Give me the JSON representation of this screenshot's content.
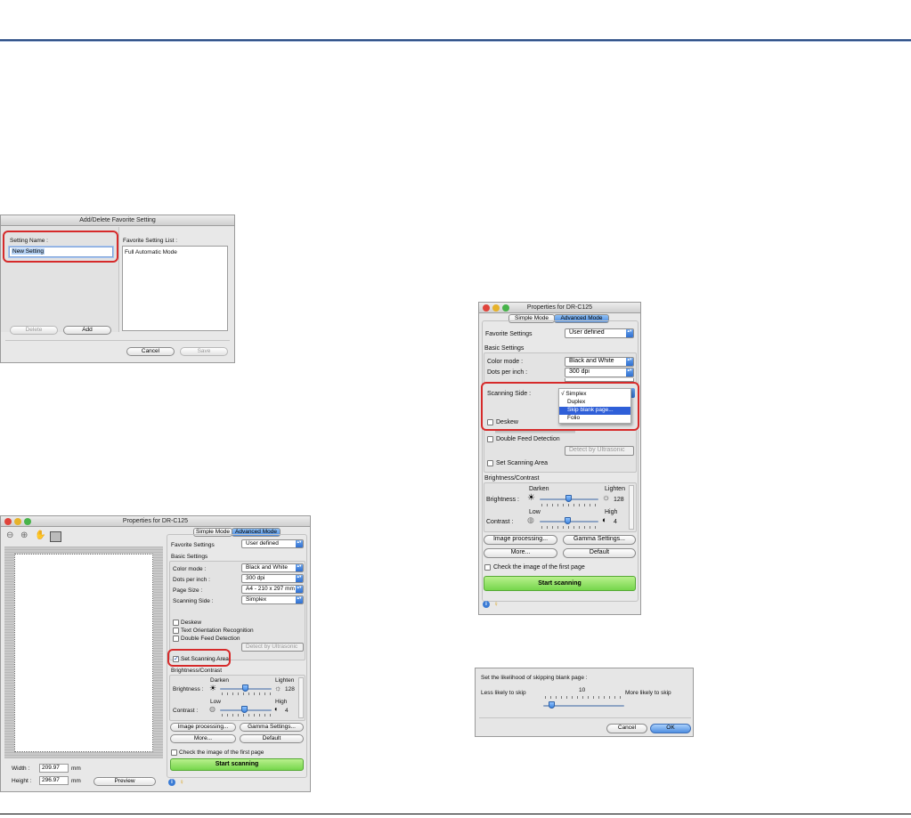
{
  "d1": {
    "title": "Add/Delete Favorite Setting",
    "setting_name_label": "Setting Name :",
    "setting_name_value": "New Setting",
    "favorite_list_label": "Favorite Setting List :",
    "favorite_list_items": [
      "Full Automatic Mode"
    ],
    "delete_label": "Delete",
    "add_label": "Add",
    "cancel_label": "Cancel",
    "save_label": "Save"
  },
  "props": {
    "title": "Properties for DR-C125",
    "tab_simple": "Simple Mode",
    "tab_advanced": "Advanced Mode",
    "favorite_label": "Favorite Settings",
    "favorite_value": "User defined",
    "basic_settings": "Basic Settings",
    "color_mode_label": "Color mode :",
    "color_mode_value": "Black and White",
    "dpi_label": "Dots per inch :",
    "dpi_value": "300 dpi",
    "page_size_label": "Page Size :",
    "page_size_value": "A4 - 210 x 297 mm",
    "scanning_side_label": "Scanning Side :",
    "scanning_side_value": "Simplex",
    "deskew": "Deskew",
    "text_orientation": "Text Orientation Recognition",
    "double_feed": "Double Feed Detection",
    "detect_by": "Detect by Ultrasonic",
    "set_scanning_area": "Set Scanning Area",
    "brightness_contrast": "Brightness/Contrast",
    "darken": "Darken",
    "lighten": "Lighten",
    "brightness_label": "Brightness :",
    "brightness_value": "128",
    "low": "Low",
    "high": "High",
    "contrast_label": "Contrast :",
    "contrast_value": "4",
    "image_processing": "Image processing...",
    "gamma_settings": "Gamma Settings...",
    "more": "More...",
    "default": "Default",
    "check_first_page": "Check the image of the first page",
    "start_scanning": "Start scanning",
    "width_label": "Width :",
    "width_value": "209.97",
    "height_label": "Height :",
    "height_value": "296.97",
    "unit_mm": "mm",
    "preview": "Preview"
  },
  "popup": {
    "items": [
      "Simplex",
      "Duplex",
      "Skip blank page...",
      "Folio"
    ],
    "checked": "√",
    "selected_index": 2
  },
  "skip": {
    "title": "Set the likelihood of skipping blank page :",
    "value": "10",
    "less": "Less likely to skip",
    "more": "More likely to skip",
    "cancel": "Cancel",
    "ok": "OK",
    "level_fraction": 0.1
  },
  "colors": {
    "accent": "#2e4f86",
    "highlight": "#d62a2a",
    "button_blue": "#4f8ee0",
    "start_green": "#76d64c"
  }
}
